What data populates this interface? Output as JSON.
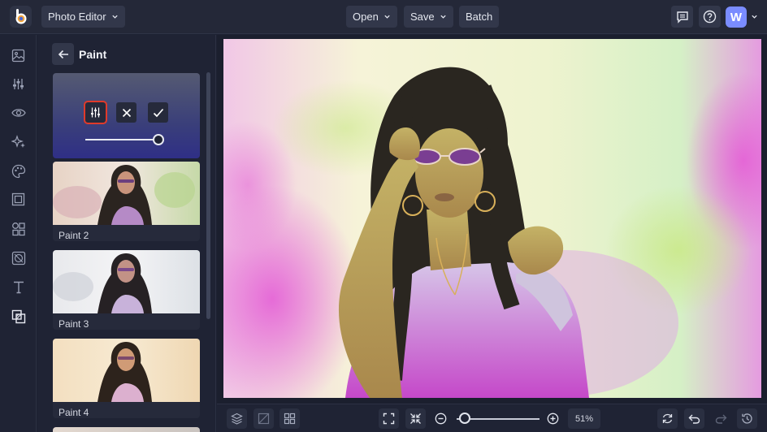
{
  "topbar": {
    "app_menu_label": "Photo Editor",
    "open_label": "Open",
    "save_label": "Save",
    "batch_label": "Batch",
    "avatar_initial": "W"
  },
  "sidenav": {
    "items": [
      "image-icon",
      "adjust-sliders-icon",
      "eye-icon",
      "sparkle-icon",
      "palette-icon",
      "frame-icon",
      "shapes-icon",
      "texture-icon",
      "text-icon",
      "overlay-icon"
    ]
  },
  "panel": {
    "title": "Paint",
    "slider_value_fraction": 0.95,
    "presets": [
      {
        "label": "Paint 2"
      },
      {
        "label": "Paint 3"
      },
      {
        "label": "Paint 4"
      }
    ]
  },
  "bottombar": {
    "zoom_label": "51%",
    "zoom_fraction": 0.1
  },
  "colors": {
    "accent": "#7a8cff",
    "highlight_outline": "#e03a2a",
    "background": "#1d2132"
  }
}
